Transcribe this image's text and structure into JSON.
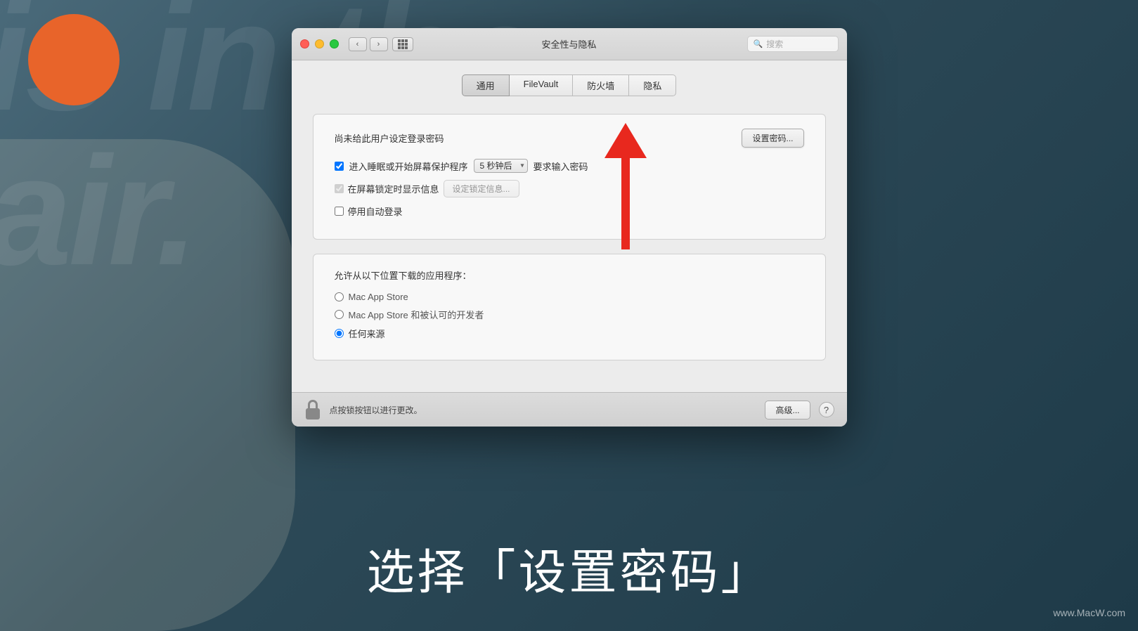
{
  "background": {
    "bg_text": "is in the\nair.",
    "caption": "选择「设置密码」",
    "watermark": "www.MacW.com"
  },
  "window": {
    "title": "安全性与隐私",
    "search_placeholder": "搜索",
    "tabs": [
      {
        "id": "general",
        "label": "通用",
        "active": true
      },
      {
        "id": "filevault",
        "label": "FileVault",
        "active": false
      },
      {
        "id": "firewall",
        "label": "防火墙",
        "active": false
      },
      {
        "id": "privacy",
        "label": "隐私",
        "active": false
      }
    ],
    "general": {
      "password_label": "尚未给此用户设定登录密码",
      "set_password_btn": "设置密码...",
      "sleep_row": {
        "prefix": "进入睡眠或开始屏幕保护程序",
        "time_value": "5 秒钟后",
        "suffix": "要求输入密码"
      },
      "show_message_checkbox": "在屏幕锁定时显示信息",
      "show_message_btn": "设定锁定信息...",
      "disable_autologin_checkbox": "停用自动登录",
      "download_label": "允许从以下位置下载的应用程序：",
      "radio_options": [
        {
          "id": "mac_app_store",
          "label": "Mac App Store",
          "selected": false
        },
        {
          "id": "mac_app_store_developers",
          "label": "Mac App Store 和被认可的开发者",
          "selected": false
        },
        {
          "id": "anywhere",
          "label": "任何来源",
          "selected": true
        }
      ]
    },
    "bottom_bar": {
      "lock_text": "点按锁按钮以进行更改。",
      "advanced_btn": "高级...",
      "help_btn": "?"
    }
  }
}
